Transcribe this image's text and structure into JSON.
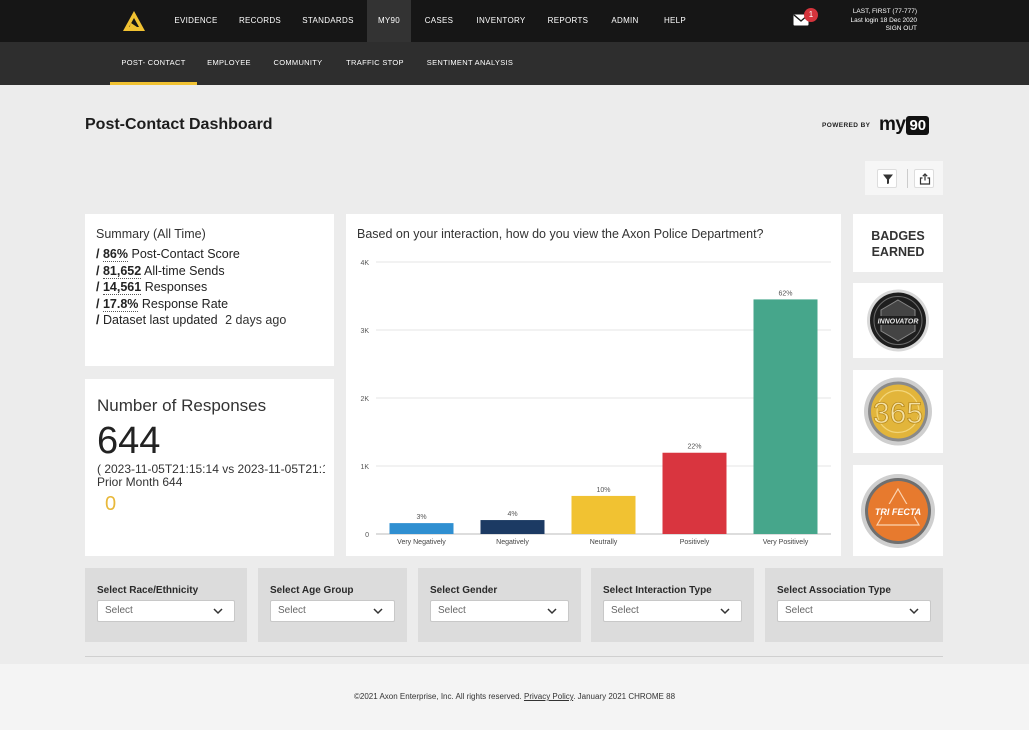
{
  "nav": {
    "items": [
      {
        "label": "EVIDENCE"
      },
      {
        "label": "RECORDS"
      },
      {
        "label": "STANDARDS"
      },
      {
        "label": "MY90"
      },
      {
        "label": "CASES"
      },
      {
        "label": "INVENTORY"
      },
      {
        "label": "REPORTS"
      },
      {
        "label": "ADMIN"
      },
      {
        "label": "HELP"
      }
    ],
    "active": "MY90",
    "mail_count": "1",
    "user_name": "LAST, FIRST (77-777)",
    "last_login": "Last login 18 Dec 2020",
    "sign_out": "SIGN OUT"
  },
  "subnav": {
    "items": [
      {
        "label": "POST- CONTACT"
      },
      {
        "label": "EMPLOYEE"
      },
      {
        "label": "COMMUNITY"
      },
      {
        "label": "TRAFFIC STOP"
      },
      {
        "label": "SENTIMENT ANALYSIS"
      }
    ],
    "active": "POST- CONTACT"
  },
  "page": {
    "title": "Post-Contact Dashboard",
    "powered_by": "POWERED BY",
    "brand_text": "my",
    "brand_num": "90"
  },
  "toolbar": {
    "filter_icon": "filter-icon",
    "export_icon": "export-icon"
  },
  "summary": {
    "title": "Summary (All Time)",
    "prefix": "/",
    "lines": [
      {
        "value": "86%",
        "label": "Post-Contact Score"
      },
      {
        "value": "81,652",
        "label": "All-time Sends"
      },
      {
        "value": "14,561",
        "label": "Responses"
      },
      {
        "value": "17.8%",
        "label": "Response Rate"
      }
    ],
    "updated_label": "Dataset last updated",
    "updated_value": "2 days ago"
  },
  "responses": {
    "title": "Number of Responses",
    "count": "644",
    "range": "( 2023-11-05T21:15:14 vs 2023-11-05T21:15:14 )",
    "prior": "Prior Month 644",
    "delta": "0"
  },
  "chart_data": {
    "type": "bar",
    "title": "Based on your interaction, how do you view the Axon Police Department?",
    "categories": [
      "Very Negatively",
      "Negatively",
      "Neutrally",
      "Positively",
      "Very Positively"
    ],
    "values": [
      160,
      205,
      560,
      1195,
      3450
    ],
    "data_labels": [
      "3%",
      "4%",
      "10%",
      "22%",
      "62%"
    ],
    "colors": [
      "#2f8fd1",
      "#1c3a63",
      "#f1c232",
      "#d9353f",
      "#46a68b"
    ],
    "ylim": [
      0,
      4000
    ],
    "yticks": [
      0,
      1000,
      2000,
      3000,
      4000
    ],
    "ytick_labels": [
      "0",
      "1K",
      "2K",
      "3K",
      "4K"
    ],
    "grid": true
  },
  "badges": {
    "title_line1": "BADGES",
    "title_line2": "EARNED",
    "items": [
      {
        "label": "INNOVATOR",
        "icon": "innovator-badge-icon"
      },
      {
        "label": "365",
        "icon": "365-badge-icon"
      },
      {
        "label": "TRI FECTA",
        "icon": "trifecta-badge-icon"
      }
    ]
  },
  "filters": [
    {
      "label": "Select Race/Ethnicity",
      "placeholder": "Select"
    },
    {
      "label": "Select Age Group",
      "placeholder": "Select"
    },
    {
      "label": "Select Gender",
      "placeholder": "Select"
    },
    {
      "label": "Select Interaction Type",
      "placeholder": "Select"
    },
    {
      "label": "Select Association Type",
      "placeholder": "Select"
    }
  ],
  "footer": {
    "copyright": "©2021 Axon Enterprise, Inc. All rights reserved.",
    "privacy": "Privacy Policy",
    "build": ". January 2021 CHROME 88"
  }
}
